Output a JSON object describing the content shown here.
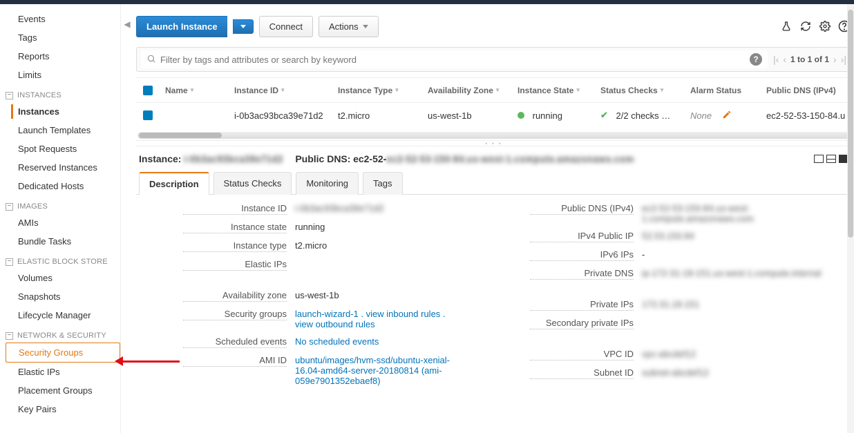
{
  "sidebar": {
    "top_items": [
      "Events",
      "Tags",
      "Reports",
      "Limits"
    ],
    "groups": [
      {
        "label": "INSTANCES",
        "items": [
          "Instances",
          "Launch Templates",
          "Spot Requests",
          "Reserved Instances",
          "Dedicated Hosts"
        ],
        "active_index": 0
      },
      {
        "label": "IMAGES",
        "items": [
          "AMIs",
          "Bundle Tasks"
        ]
      },
      {
        "label": "ELASTIC BLOCK STORE",
        "items": [
          "Volumes",
          "Snapshots",
          "Lifecycle Manager"
        ]
      },
      {
        "label": "NETWORK & SECURITY",
        "items": [
          "Security Groups",
          "Elastic IPs",
          "Placement Groups",
          "Key Pairs"
        ],
        "highlight_index": 0
      }
    ]
  },
  "toolbar": {
    "launch": "Launch Instance",
    "connect": "Connect",
    "actions": "Actions"
  },
  "filter": {
    "placeholder": "Filter by tags and attributes or search by keyword",
    "pager_text": "1 to 1 of 1"
  },
  "table": {
    "columns": [
      "Name",
      "Instance ID",
      "Instance Type",
      "Availability Zone",
      "Instance State",
      "Status Checks",
      "Alarm Status",
      "Public DNS (IPv4)"
    ],
    "row": {
      "name": "",
      "instance_id": "i-0b3ac93bca39e71d2",
      "instance_type": "t2.micro",
      "az": "us-west-1b",
      "state": "running",
      "status_checks": "2/2 checks …",
      "alarm_status": "None",
      "public_dns": "ec2-52-53-150-84.u"
    }
  },
  "detail": {
    "header_instance_label": "Instance:",
    "header_instance_value": "i-0b3ac93bca39e71d2",
    "header_dns_label": "Public DNS:",
    "header_dns_value": "ec2-52-53-150-84.us-west-1.compute.amazonaws.com",
    "tabs": [
      "Description",
      "Status Checks",
      "Monitoring",
      "Tags"
    ],
    "active_tab": 0,
    "left": [
      {
        "label": "Instance ID",
        "value": "i-0b3ac93bca39e71d2",
        "blur": true
      },
      {
        "label": "Instance state",
        "value": "running"
      },
      {
        "label": "Instance type",
        "value": "t2.micro"
      },
      {
        "label": "Elastic IPs",
        "value": ""
      },
      {
        "label": "Availability zone",
        "value": "us-west-1b"
      },
      {
        "label": "Security groups",
        "value_links": [
          "launch-wizard-1 .",
          "view inbound rules .",
          "view outbound rules"
        ]
      },
      {
        "label": "Scheduled events",
        "value_link": "No scheduled events"
      },
      {
        "label": "AMI ID",
        "value_link": "ubuntu/images/hvm-ssd/ubuntu-xenial-16.04-amd64-server-20180814 (ami-059e7901352ebaef8)"
      }
    ],
    "right": [
      {
        "label": "Public DNS (IPv4)",
        "value": "ec2-52-53-150-84.us-west-1.compute.amazonaws.com",
        "blur": true
      },
      {
        "label": "IPv4 Public IP",
        "value": "52.53.150.84",
        "blur": true
      },
      {
        "label": "IPv6 IPs",
        "value": "-"
      },
      {
        "label": "Private DNS",
        "value": "ip-172-31-18-151.us-west-1.compute.internal",
        "blur": true
      },
      {
        "label": "Private IPs",
        "value": "172.31.18.151",
        "blur": true
      },
      {
        "label": "Secondary private IPs",
        "value": ""
      },
      {
        "label": "VPC ID",
        "value": "vpc-abcdef12",
        "blur": true
      },
      {
        "label": "Subnet ID",
        "value": "subnet-abcdef12",
        "blur": true
      }
    ]
  }
}
